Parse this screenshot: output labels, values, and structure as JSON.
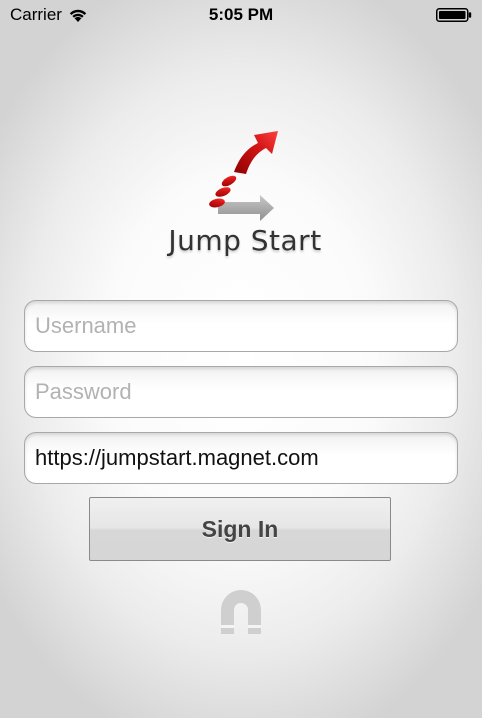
{
  "status_bar": {
    "carrier": "Carrier",
    "time": "5:05 PM",
    "wifi_icon": "wifi-icon",
    "battery_icon": "battery-icon"
  },
  "logo": {
    "title": "Jump Start",
    "icon": "jump-arrow-icon",
    "colors": {
      "red": "#cc1111",
      "gray": "#9a9a9a"
    }
  },
  "form": {
    "username": {
      "placeholder": "Username",
      "value": ""
    },
    "password": {
      "placeholder": "Password",
      "value": ""
    },
    "server_url": {
      "placeholder": "",
      "value": "https://jumpstart.magnet.com"
    },
    "sign_in_label": "Sign In"
  },
  "footer": {
    "icon": "magnet-icon"
  }
}
